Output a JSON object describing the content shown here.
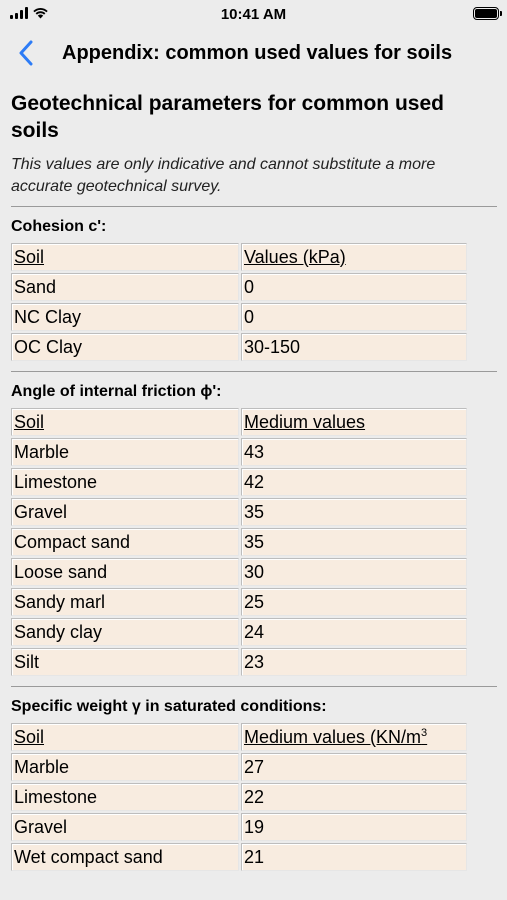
{
  "status_bar": {
    "time": "10:41 AM"
  },
  "nav": {
    "title": "Appendix: common used values for soils"
  },
  "page": {
    "heading": "Geotechnical parameters for common used soils",
    "intro": "This values are only indicative and cannot substitute a more accurate geotechnical survey."
  },
  "cohesion": {
    "title": "Cohesion c':",
    "col_soil": "Soil",
    "col_value": "Values (kPa)",
    "rows": [
      {
        "soil": "Sand",
        "value": "0"
      },
      {
        "soil": "NC Clay",
        "value": "0"
      },
      {
        "soil": "OC Clay",
        "value": "30-150"
      }
    ]
  },
  "friction": {
    "title": "Angle of internal friction ɸ':",
    "col_soil": "Soil",
    "col_value": "Medium values",
    "rows": [
      {
        "soil": "Marble",
        "value": "43"
      },
      {
        "soil": "Limestone",
        "value": "42"
      },
      {
        "soil": "Gravel",
        "value": "35"
      },
      {
        "soil": "Compact sand",
        "value": "35"
      },
      {
        "soil": "Loose sand",
        "value": "30"
      },
      {
        "soil": "Sandy marl",
        "value": "25"
      },
      {
        "soil": "Sandy clay",
        "value": "24"
      },
      {
        "soil": "Silt",
        "value": "23"
      }
    ]
  },
  "weight": {
    "title": "Specific weight γ in saturated conditions:",
    "col_soil": "Soil",
    "col_value": "Medium values (KN/m",
    "col_value_sup": "3",
    "rows": [
      {
        "soil": "Marble",
        "value": "27"
      },
      {
        "soil": "Limestone",
        "value": "22"
      },
      {
        "soil": "Gravel",
        "value": "19"
      },
      {
        "soil": "Wet compact sand",
        "value": "21"
      }
    ]
  }
}
